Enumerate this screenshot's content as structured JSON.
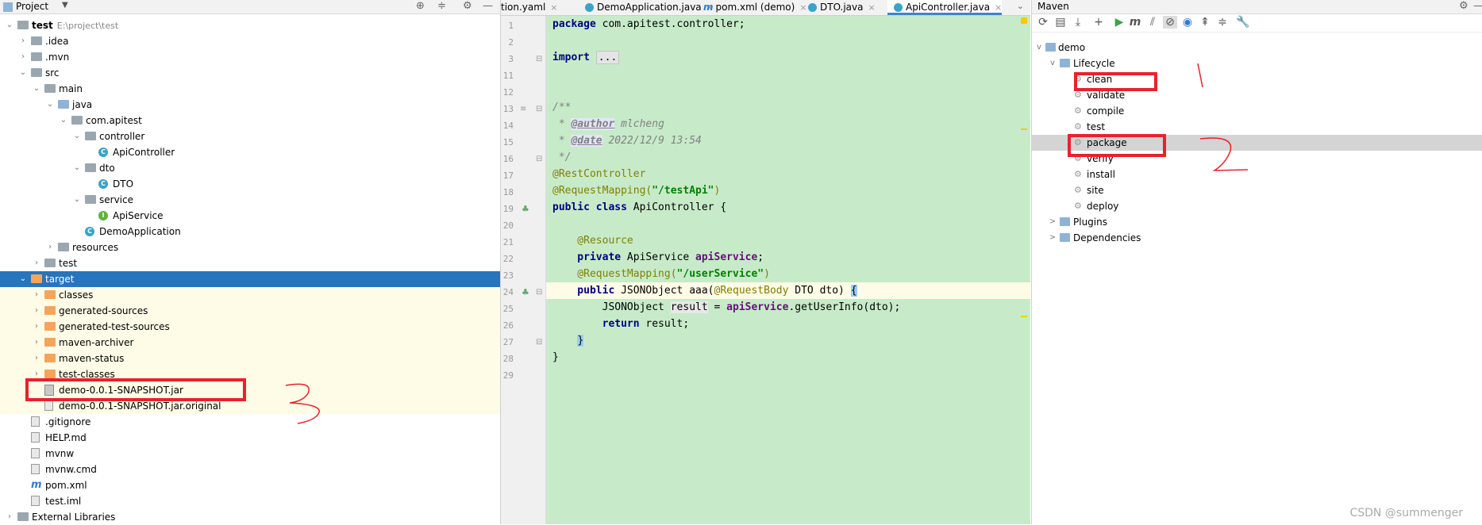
{
  "project_panel": {
    "title": "Project",
    "tree": [
      {
        "label": "test",
        "hint": "E:\\project\\test",
        "bold": true,
        "indent": 0,
        "arrow": "v",
        "icon": "folder"
      },
      {
        "label": ".idea",
        "indent": 1,
        "arrow": ">",
        "icon": "folder"
      },
      {
        "label": ".mvn",
        "indent": 1,
        "arrow": ">",
        "icon": "folder"
      },
      {
        "label": "src",
        "indent": 1,
        "arrow": "v",
        "icon": "folder"
      },
      {
        "label": "main",
        "indent": 2,
        "arrow": "v",
        "icon": "folder"
      },
      {
        "label": "java",
        "indent": 3,
        "arrow": "v",
        "icon": "folder-blue"
      },
      {
        "label": "com.apitest",
        "indent": 4,
        "arrow": "v",
        "icon": "package"
      },
      {
        "label": "controller",
        "indent": 5,
        "arrow": "v",
        "icon": "package"
      },
      {
        "label": "ApiController",
        "indent": 6,
        "arrow": "",
        "icon": "class"
      },
      {
        "label": "dto",
        "indent": 5,
        "arrow": "v",
        "icon": "package"
      },
      {
        "label": "DTO",
        "indent": 6,
        "arrow": "",
        "icon": "class"
      },
      {
        "label": "service",
        "indent": 5,
        "arrow": "v",
        "icon": "package"
      },
      {
        "label": "ApiService",
        "indent": 6,
        "arrow": "",
        "icon": "interface"
      },
      {
        "label": "DemoApplication",
        "indent": 5,
        "arrow": "",
        "icon": "class"
      },
      {
        "label": "resources",
        "indent": 3,
        "arrow": ">",
        "icon": "folder"
      },
      {
        "label": "test",
        "indent": 2,
        "arrow": ">",
        "icon": "folder"
      },
      {
        "label": "target",
        "indent": 1,
        "arrow": "v",
        "icon": "folder-orange",
        "selected": true
      },
      {
        "label": "classes",
        "indent": 2,
        "arrow": ">",
        "icon": "folder-orange",
        "hl": true
      },
      {
        "label": "generated-sources",
        "indent": 2,
        "arrow": ">",
        "icon": "folder-orange",
        "hl": true
      },
      {
        "label": "generated-test-sources",
        "indent": 2,
        "arrow": ">",
        "icon": "folder-orange",
        "hl": true
      },
      {
        "label": "maven-archiver",
        "indent": 2,
        "arrow": ">",
        "icon": "folder-orange",
        "hl": true
      },
      {
        "label": "maven-status",
        "indent": 2,
        "arrow": ">",
        "icon": "folder-orange",
        "hl": true
      },
      {
        "label": "test-classes",
        "indent": 2,
        "arrow": ">",
        "icon": "folder-orange",
        "hl": true
      },
      {
        "label": "demo-0.0.1-SNAPSHOT.jar",
        "indent": 2,
        "arrow": "",
        "icon": "jar",
        "hl": true
      },
      {
        "label": "demo-0.0.1-SNAPSHOT.jar.original",
        "indent": 2,
        "arrow": "",
        "icon": "file",
        "hl": true
      },
      {
        "label": ".gitignore",
        "indent": 1,
        "arrow": "",
        "icon": "file"
      },
      {
        "label": "HELP.md",
        "indent": 1,
        "arrow": "",
        "icon": "md"
      },
      {
        "label": "mvnw",
        "indent": 1,
        "arrow": "",
        "icon": "file"
      },
      {
        "label": "mvnw.cmd",
        "indent": 1,
        "arrow": "",
        "icon": "file"
      },
      {
        "label": "pom.xml",
        "indent": 1,
        "arrow": "",
        "icon": "maven"
      },
      {
        "label": "test.iml",
        "indent": 1,
        "arrow": "",
        "icon": "file"
      },
      {
        "label": "External Libraries",
        "indent": 0,
        "arrow": ">",
        "icon": "lib"
      }
    ]
  },
  "editor": {
    "tabs": [
      {
        "label": "tion.yaml",
        "icon": "",
        "active": false
      },
      {
        "label": "DemoApplication.java",
        "icon": "class",
        "active": false
      },
      {
        "label": "pom.xml (demo)",
        "icon": "maven",
        "active": false
      },
      {
        "label": "DTO.java",
        "icon": "class",
        "active": false
      },
      {
        "label": "ApiController.java",
        "icon": "class",
        "active": true
      }
    ],
    "close_glyph": "×",
    "line_numbers": [
      "1",
      "2",
      "3",
      "11",
      "12",
      "13",
      "14",
      "15",
      "16",
      "17",
      "18",
      "19",
      "20",
      "21",
      "22",
      "23",
      "24",
      "25",
      "26",
      "27",
      "28",
      "29"
    ],
    "code": {
      "l1_kw": "package",
      "l1_rest": " com.apitest.controller;",
      "l3_kw": "import",
      "l3_dots": "...",
      "l12": "/**",
      "l13_pre": " * ",
      "l13_tag": "@author",
      "l13_val": " mlcheng",
      "l14_pre": " * ",
      "l14_tag": "@date",
      "l14_val": " 2022/12/9 13:54",
      "l15": " */",
      "l16": "@RestController",
      "l17_an": "@RequestMapping(",
      "l17_st": "\"/testApi\"",
      "l17_end": ")",
      "l18_kw": "public class",
      "l18_rest": " ApiController {",
      "l20": "    @Resource",
      "l21_kw": "    private",
      "l21_type": " ApiService ",
      "l21_fld": "apiService",
      "l21_end": ";",
      "l23_an": "    @RequestMapping(",
      "l23_st": "\"/userService\"",
      "l23_end": ")",
      "l24_kw": "    public",
      "l24_a": " JSONObject aaa(",
      "l24_an": "@RequestBody",
      "l24_b": " DTO dto) ",
      "l24_br": "{",
      "l25_a": "        JSONObject ",
      "l25_var": "result",
      "l25_b": " = ",
      "l25_fld": "apiService",
      "l25_c": ".getUserInfo(dto);",
      "l26_kw": "        return",
      "l26_rest": " result;",
      "l27_pre": "    ",
      "l27_br": "}",
      "l28": "}"
    }
  },
  "maven_panel": {
    "title": "Maven",
    "tree": {
      "root": "demo",
      "lifecycle": "Lifecycle",
      "goals": [
        "clean",
        "validate",
        "compile",
        "test",
        "package",
        "verify",
        "install",
        "site",
        "deploy"
      ],
      "selected_goal": "package",
      "plugins": "Plugins",
      "dependencies": "Dependencies"
    }
  },
  "annotations": {
    "mark_1": "1",
    "mark_2": "2",
    "mark_3": "3",
    "color": "#e8222b"
  },
  "watermark": "CSDN @summenger"
}
